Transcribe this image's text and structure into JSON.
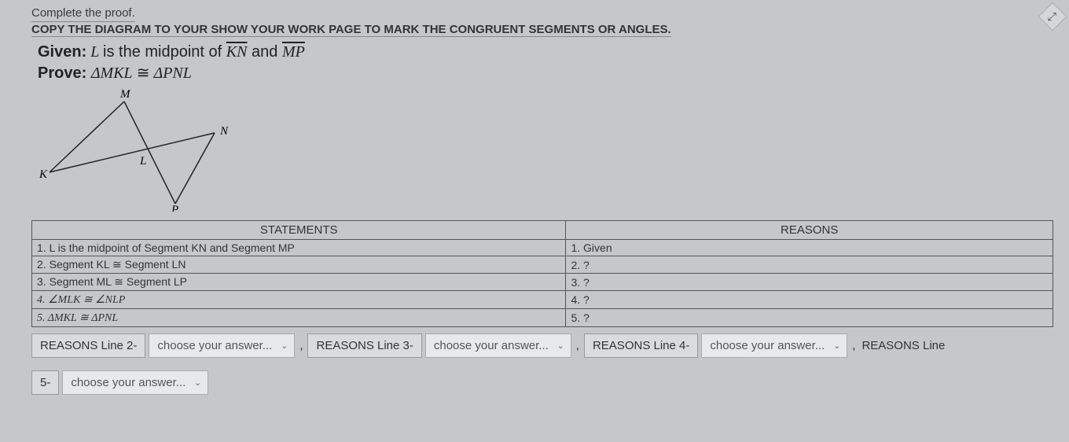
{
  "instructions": {
    "line1": "Complete the proof.",
    "line2": "COPY THE DIAGRAM TO YOUR SHOW YOUR WORK PAGE TO MARK THE CONGRUENT SEGMENTS OR ANGLES."
  },
  "given": {
    "label": "Given:",
    "text_pre": " L ",
    "text_mid": "is the midpoint of ",
    "seg1": "KN",
    "and": " and ",
    "seg2": "MP"
  },
  "prove": {
    "label": "Prove:",
    "tri1": "ΔMKL",
    "cong": " ≅ ",
    "tri2": "ΔPNL"
  },
  "diagram_labels": {
    "M": "M",
    "N": "N",
    "K": "K",
    "L": "L",
    "P": "P"
  },
  "table": {
    "headers": {
      "statements": "STATEMENTS",
      "reasons": "REASONS"
    },
    "rows": [
      {
        "statement": "1. L is the midpoint of Segment KN and Segment MP",
        "reason": "1. Given"
      },
      {
        "statement": "2. Segment KL ≅ Segment LN",
        "reason": "2. ?"
      },
      {
        "statement": "3. Segment ML ≅ Segment LP",
        "reason": "3. ?"
      },
      {
        "statement": "4. ∠MLK ≅ ∠NLP",
        "reason": "4. ?"
      },
      {
        "statement": "5. ΔMKL ≅ ΔPNL",
        "reason": "5. ?"
      }
    ]
  },
  "answers": {
    "label2": "REASONS Line 2-",
    "label3": "REASONS Line 3-",
    "label4": "REASONS Line 4-",
    "label5": "REASONS Line",
    "label5_prefix": "5-",
    "placeholder": "choose your answer...",
    "comma": ","
  }
}
